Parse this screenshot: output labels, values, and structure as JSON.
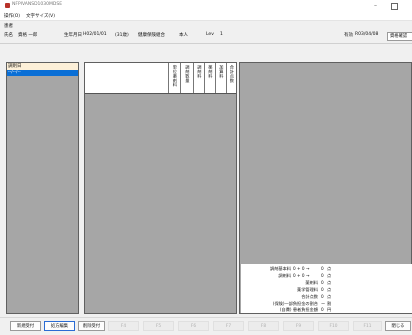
{
  "window": {
    "title": "NFPIVANSD1030MDSE"
  },
  "menu": [
    "操作(O)",
    "文字サイズ(V)"
  ],
  "patient": {
    "tag": "患者",
    "name_label": "氏名",
    "name": "資格 一郎",
    "birth_label": "生年月日",
    "birth_date": "H02/01/01",
    "age": "(31歳)",
    "insurance": "健康保険組合",
    "relation": "本人",
    "lev_label": "Lev",
    "lev_value": "1",
    "valid_label": "有効",
    "valid_date": "R03/04/08",
    "confirm_button": "資格確認"
  },
  "left_list": {
    "header": "調剤日",
    "selected_row": "--/--/--"
  },
  "grid_columns": [
    "単位薬剤料",
    "調剤数量",
    "調剤料",
    "薬剤料",
    "加算料",
    "合計点数"
  ],
  "summary": [
    {
      "label": "調剤基本料",
      "value": "0 + 0 →",
      "points": "0",
      "unit": "点"
    },
    {
      "label": "調剤料",
      "value": "0 + 0 →",
      "points": "0",
      "unit": "点"
    },
    {
      "label": "薬剤料",
      "value": "",
      "points": "0",
      "unit": "点"
    },
    {
      "label": "薬学管理料",
      "value": "",
      "points": "0",
      "unit": "点"
    },
    {
      "label": "合計点数",
      "value": "",
      "points": "0",
      "unit": "点"
    },
    {
      "label": "(保険)一部負担金の割合",
      "value": "",
      "points": "ー",
      "unit": "割"
    },
    {
      "label": "(自費) 患者負担金額",
      "value": "",
      "points": "0",
      "unit": "円"
    }
  ],
  "toolbar": {
    "b1": "新規受付",
    "b2": "処方編集",
    "b3": "削除受付",
    "f4": "F4",
    "f5": "F5",
    "f6": "F6",
    "f7": "F7",
    "f8": "F8",
    "f9": "F9",
    "f10": "F10",
    "f11": "F11",
    "close": "閉じる"
  }
}
